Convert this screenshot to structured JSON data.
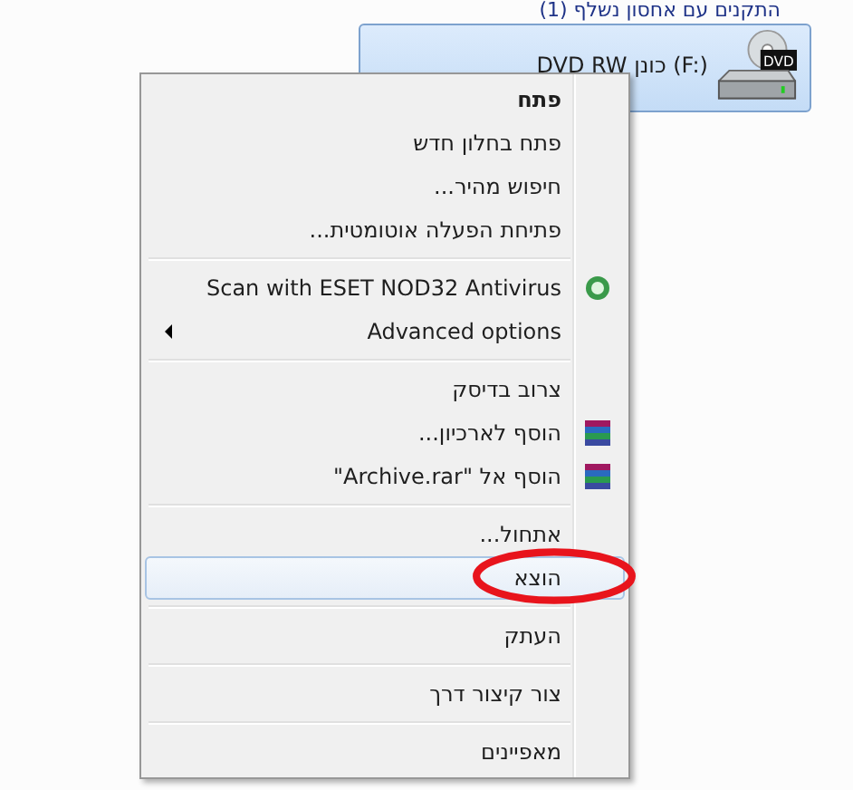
{
  "section_header": "התקנים עם אחסון נשלף (1)",
  "drive": {
    "label": "DVD RW כונן (F:)",
    "badge": "DVD",
    "selected": true
  },
  "context_menu": {
    "groups": [
      {
        "items": [
          {
            "label": "פתח",
            "bold": true,
            "kind": "plain",
            "submenu": false,
            "hovered": false
          },
          {
            "label": "פתח בחלון חדש",
            "bold": false,
            "kind": "plain",
            "submenu": false,
            "hovered": false
          },
          {
            "label": "חיפוש מהיר...",
            "bold": false,
            "kind": "plain",
            "submenu": false,
            "hovered": false
          },
          {
            "label": "פתיחת הפעלה אוטומטית...",
            "bold": false,
            "kind": "plain",
            "submenu": false,
            "hovered": false
          }
        ]
      },
      {
        "items": [
          {
            "label": "Scan with ESET NOD32 Antivirus",
            "bold": false,
            "kind": "antivirus",
            "submenu": false,
            "hovered": false
          },
          {
            "label": "Advanced options",
            "bold": false,
            "kind": "plain",
            "submenu": true,
            "hovered": false
          }
        ]
      },
      {
        "items": [
          {
            "label": "צרוב בדיסק",
            "bold": false,
            "kind": "plain",
            "submenu": false,
            "hovered": false
          },
          {
            "label": "הוסף לארכיון...",
            "bold": false,
            "kind": "archive",
            "submenu": false,
            "hovered": false
          },
          {
            "label": "הוסף אל \"Archive.rar\"",
            "bold": false,
            "kind": "archive",
            "submenu": false,
            "hovered": false
          }
        ]
      },
      {
        "items": [
          {
            "label": "אתחול...",
            "bold": false,
            "kind": "plain",
            "submenu": false,
            "hovered": false
          },
          {
            "label": "הוצא",
            "bold": false,
            "kind": "plain",
            "submenu": false,
            "hovered": true,
            "circled": true
          }
        ]
      },
      {
        "items": [
          {
            "label": "העתק",
            "bold": false,
            "kind": "plain",
            "submenu": false,
            "hovered": false
          }
        ]
      },
      {
        "items": [
          {
            "label": "צור קיצור דרך",
            "bold": false,
            "kind": "plain",
            "submenu": false,
            "hovered": false
          }
        ]
      },
      {
        "items": [
          {
            "label": "מאפיינים",
            "bold": false,
            "kind": "plain",
            "submenu": false,
            "hovered": false
          }
        ]
      }
    ]
  }
}
